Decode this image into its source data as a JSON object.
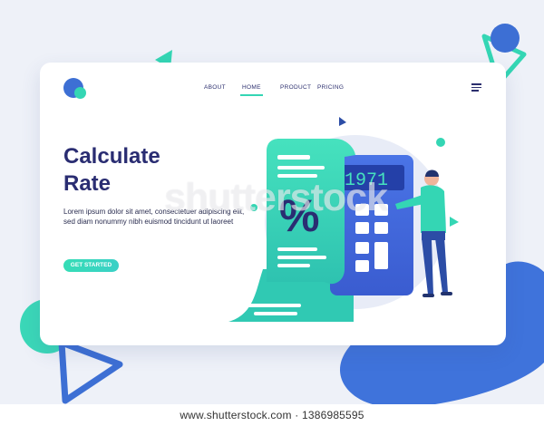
{
  "nav": {
    "items": [
      {
        "label": "ABOUT",
        "active": false
      },
      {
        "label": "HOME",
        "active": true
      },
      {
        "label": "PRODUCT",
        "active": false
      },
      {
        "label": "PRICING",
        "active": false
      }
    ]
  },
  "hero": {
    "title_line1": "Calculate",
    "title_line2": "Rate",
    "description": "Lorem ipsum dolor sit amet, consectetuer adipiscing elit, sed diam nonummy nibh euismod tincidunt ut laoreet",
    "cta_label": "GET STARTED"
  },
  "illustration": {
    "calculator_display": "1971",
    "receipt_symbol": "%"
  },
  "watermark": "shutterstock",
  "footer": {
    "url": "www.shutterstock.com · 1386985595"
  },
  "colors": {
    "navy": "#2a2d72",
    "teal": "#34d6b4",
    "blue": "#3d6fd4",
    "background": "#eef1f8"
  }
}
